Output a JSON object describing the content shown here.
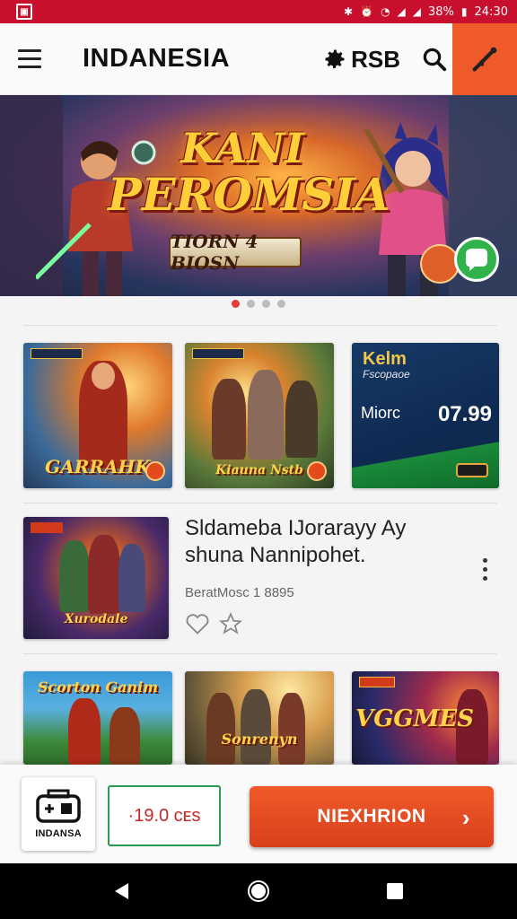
{
  "status_bar": {
    "time": "24:30",
    "battery": "38%"
  },
  "app_bar": {
    "title": "INDANESIA",
    "action_text": "RSB"
  },
  "banner": {
    "title_line1": "KANI",
    "title_line2": "PEROMSIA",
    "subtitle": "TIORN 4 BIOSN",
    "page_count": 4,
    "active_page": 0
  },
  "tiles_row1": [
    {
      "caption": "GARRAHK"
    },
    {
      "caption": "Kiauna Nstb"
    },
    {
      "title": "Kelm",
      "subtitle": "Fscopaoe",
      "label": "Miorc",
      "price": "07.99"
    }
  ],
  "list_item": {
    "title_line1": "Sldameba IJorarayy Ay",
    "title_line2": "shuna Nannipohet.",
    "meta": "BeratMosc 1 8895",
    "thumb_caption": "Xurodale"
  },
  "tiles_row2": [
    {
      "caption": "Scorton Ganim"
    },
    {
      "caption": "Sonrenyn"
    },
    {
      "caption": "VGGMES"
    }
  ],
  "bottom_bar": {
    "brand_label": "INDANSA",
    "price": "·19.0 ᴄᴇs",
    "cta_label": "NIEXHRION"
  },
  "colors": {
    "status_bar": "#c8102e",
    "accent": "#ef5a2a",
    "price_border": "#2e9a4e"
  }
}
